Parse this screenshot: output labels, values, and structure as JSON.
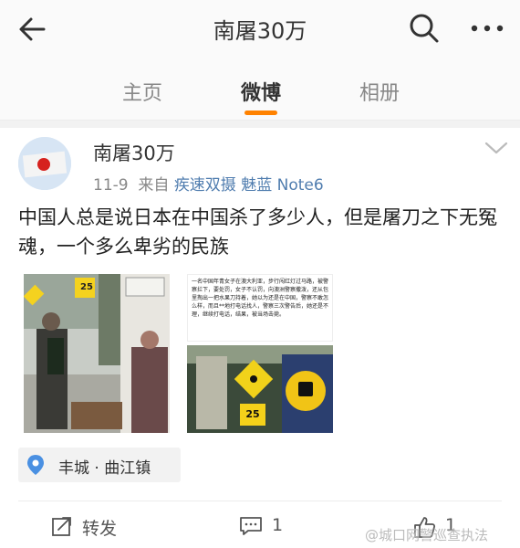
{
  "header": {
    "title": "南屠30万"
  },
  "tabs": [
    {
      "label": "主页"
    },
    {
      "label": "微博"
    },
    {
      "label": "相册"
    }
  ],
  "post": {
    "author": "南屠30万",
    "date": "11-9",
    "source_prefix": "来自",
    "source": "疾速双摄 魅蓝 Note6",
    "content": "中国人总是说日本在中国杀了多少人，但是屠刀之下无冤魂，一个多么卑劣的民族",
    "images": {
      "right_top_text": "一名中国年青女子在澳大利亚，步行闯红灯过马路，被警察拦下，要处罚，女子不认罚，向澳洲警察撒泼，还从包里掏出一把水果刀持着，她以为还是在中国，警察不敢怎么样，而且**地打电话找人，警察三次警告后，她还是不理，继续打电话，结果，被当场击毙。",
      "speed_sign": "25"
    },
    "location": "丰城 · 曲江镇"
  },
  "actions": {
    "repost_label": "转发",
    "comment_count": "1",
    "like_count": "1"
  },
  "watermark": "@城口网警巡查执法",
  "colors": {
    "accent": "#ff8200",
    "link": "#507daf"
  }
}
